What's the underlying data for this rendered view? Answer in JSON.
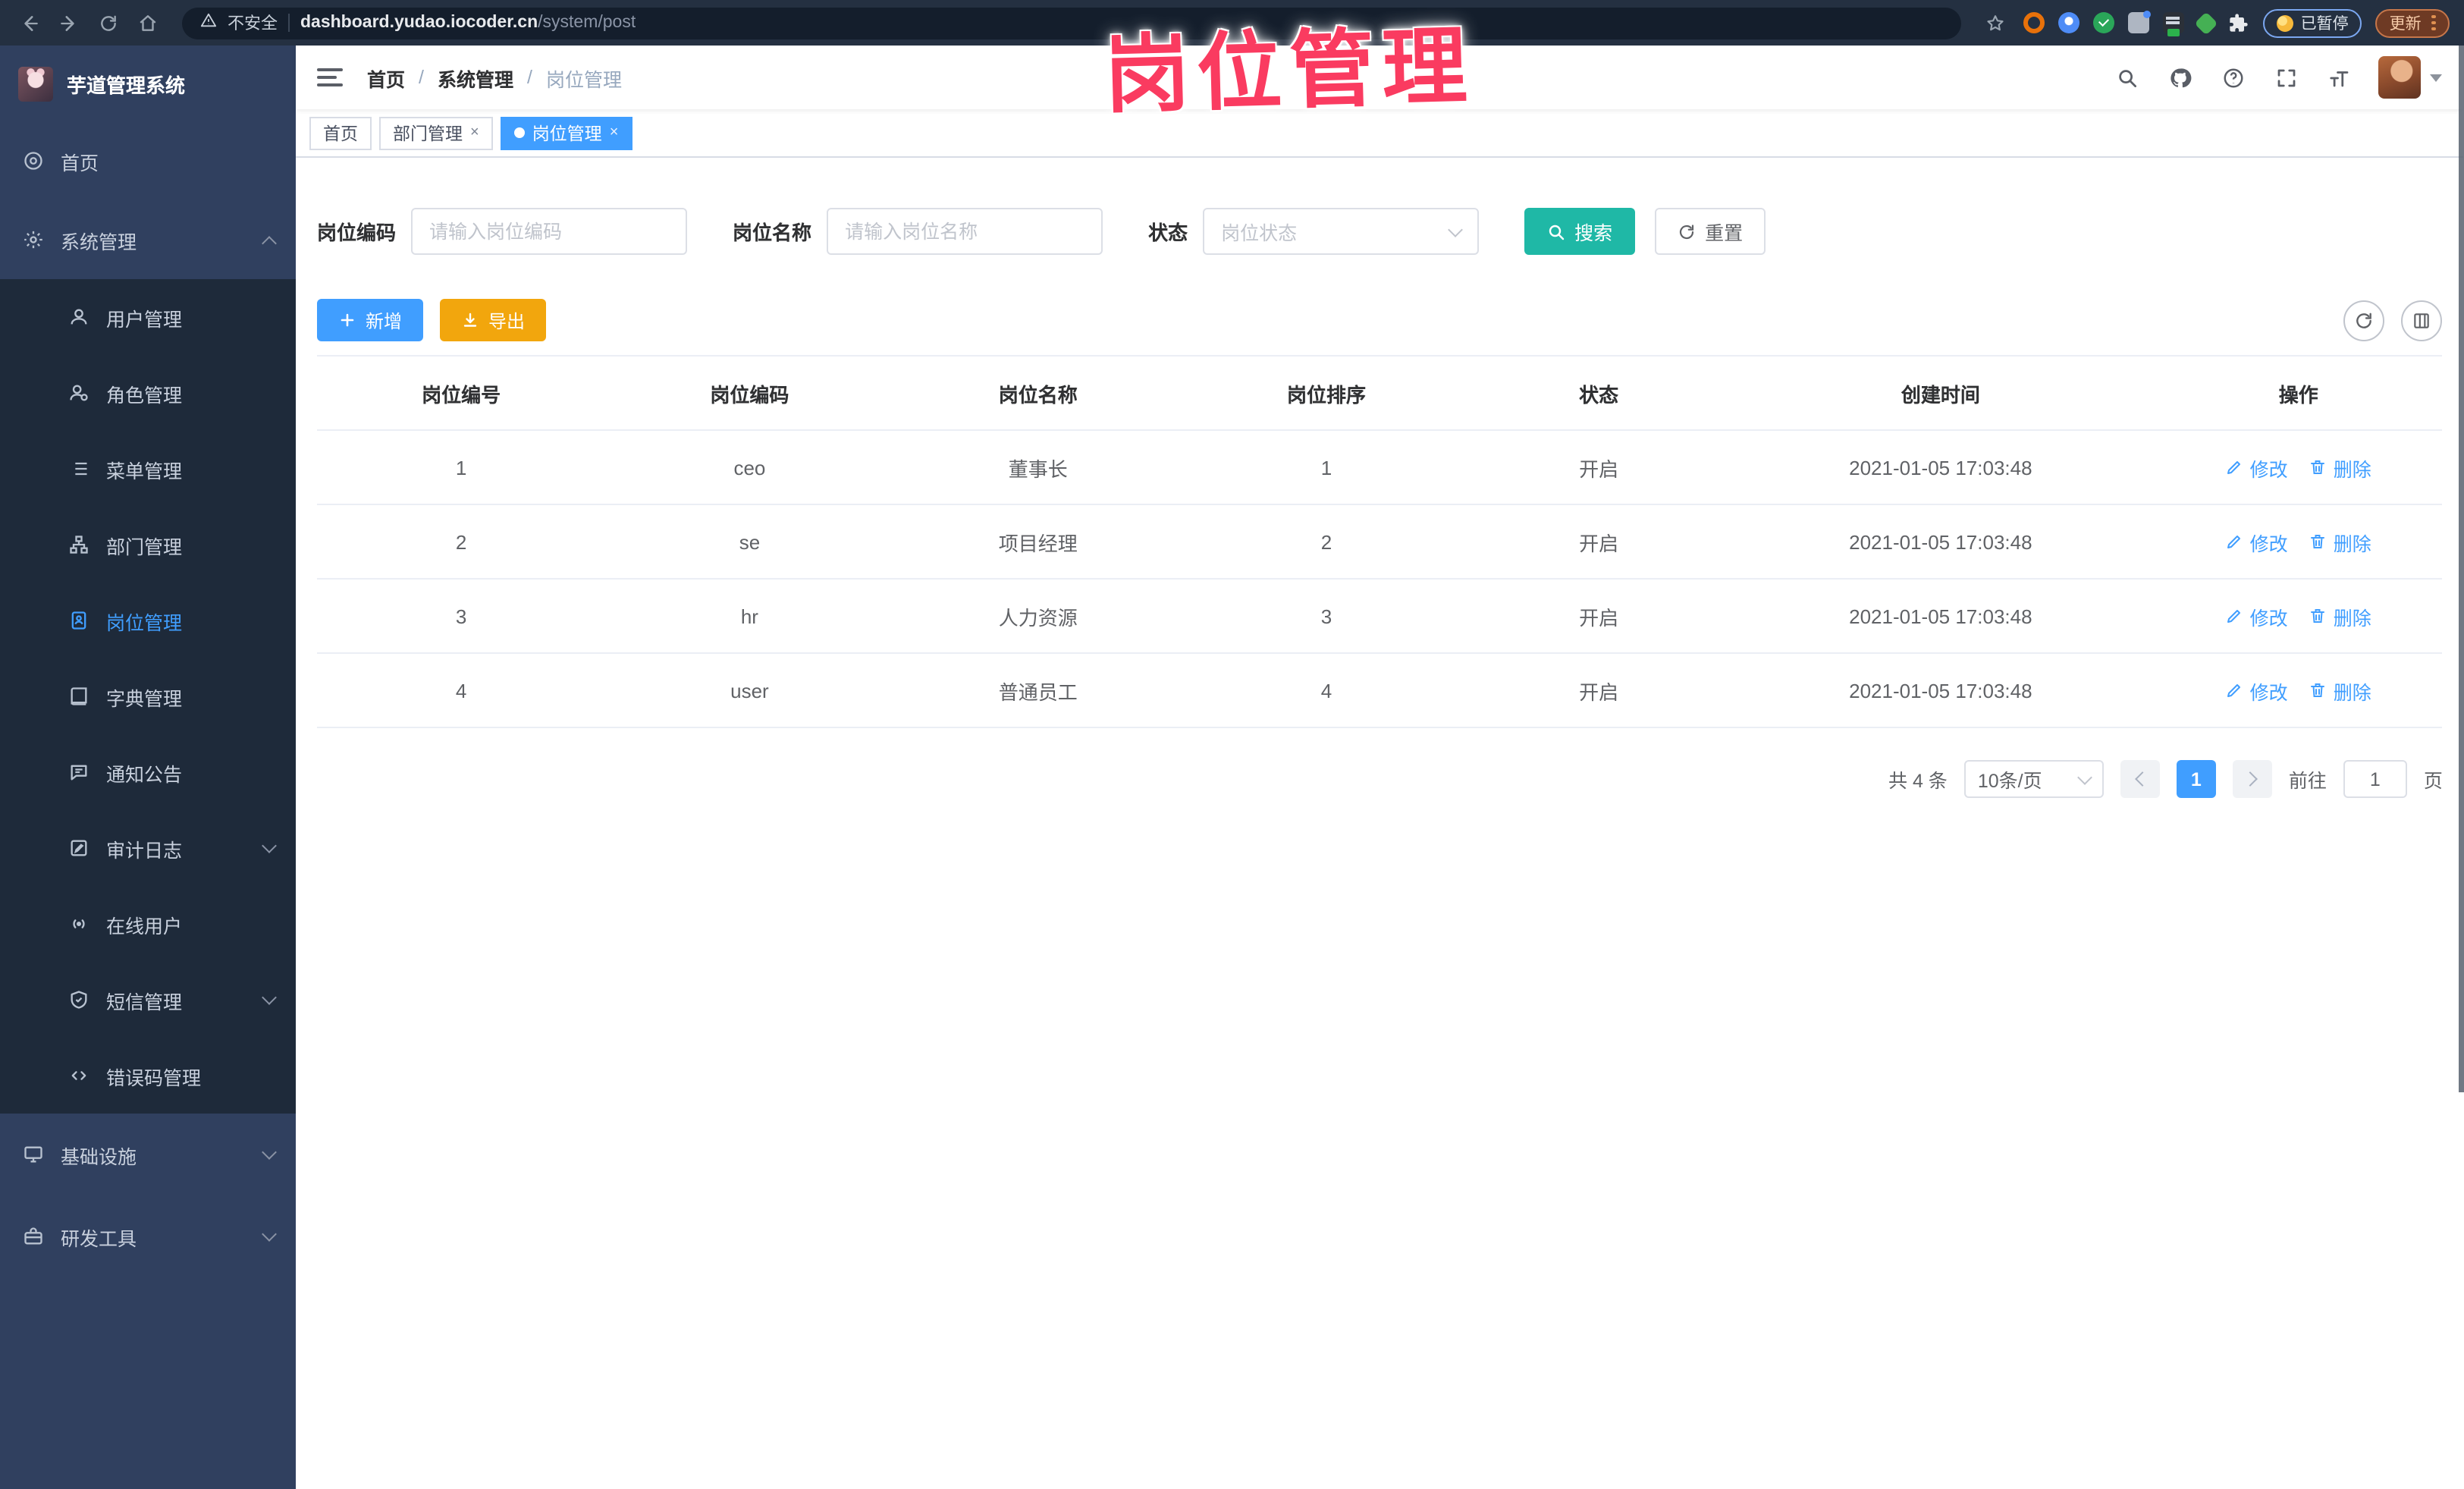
{
  "browser": {
    "security_label": "不安全",
    "url_host": "dashboard.yudao.iocoder.cn",
    "url_path": "/system/post",
    "paused_label": "已暂停",
    "update_label": "更新"
  },
  "watermark": "岗位管理",
  "sidebar": {
    "title": "芋道管理系统",
    "home_label": "首页",
    "system_label": "系统管理",
    "system_children": [
      "用户管理",
      "角色管理",
      "菜单管理",
      "部门管理",
      "岗位管理",
      "字典管理",
      "通知公告",
      "审计日志",
      "在线用户",
      "短信管理",
      "错误码管理"
    ],
    "infra_label": "基础设施",
    "devtools_label": "研发工具"
  },
  "breadcrumb": [
    "首页",
    "系统管理",
    "岗位管理"
  ],
  "tabs": {
    "home": "首页",
    "dept": "部门管理",
    "post": "岗位管理"
  },
  "filters": {
    "code_label": "岗位编码",
    "code_placeholder": "请输入岗位编码",
    "name_label": "岗位名称",
    "name_placeholder": "请输入岗位名称",
    "status_label": "状态",
    "status_placeholder": "岗位状态",
    "search_label": "搜索",
    "reset_label": "重置"
  },
  "toolbar": {
    "add_label": "新增",
    "export_label": "导出"
  },
  "table": {
    "columns": [
      "岗位编号",
      "岗位编码",
      "岗位名称",
      "岗位排序",
      "状态",
      "创建时间",
      "操作"
    ],
    "rows": [
      [
        "1",
        "ceo",
        "董事长",
        "1",
        "开启",
        "2021-01-05 17:03:48"
      ],
      [
        "2",
        "se",
        "项目经理",
        "2",
        "开启",
        "2021-01-05 17:03:48"
      ],
      [
        "3",
        "hr",
        "人力资源",
        "3",
        "开启",
        "2021-01-05 17:03:48"
      ],
      [
        "4",
        "user",
        "普通员工",
        "4",
        "开启",
        "2021-01-05 17:03:48"
      ]
    ],
    "edit_label": "修改",
    "delete_label": "删除"
  },
  "pagination": {
    "total_text": "共 4 条",
    "page_size": "10条/页",
    "current_page": "1",
    "goto_label": "前往",
    "goto_value": "1",
    "page_unit": "页"
  },
  "colors": {
    "primary": "#409eff",
    "search_teal": "#1fb8a6",
    "export_orange": "#f2a60d",
    "watermark_pink": "#fa3b60",
    "sidebar_bg": "#30405f",
    "submenu_bg": "#1e2a3a"
  }
}
